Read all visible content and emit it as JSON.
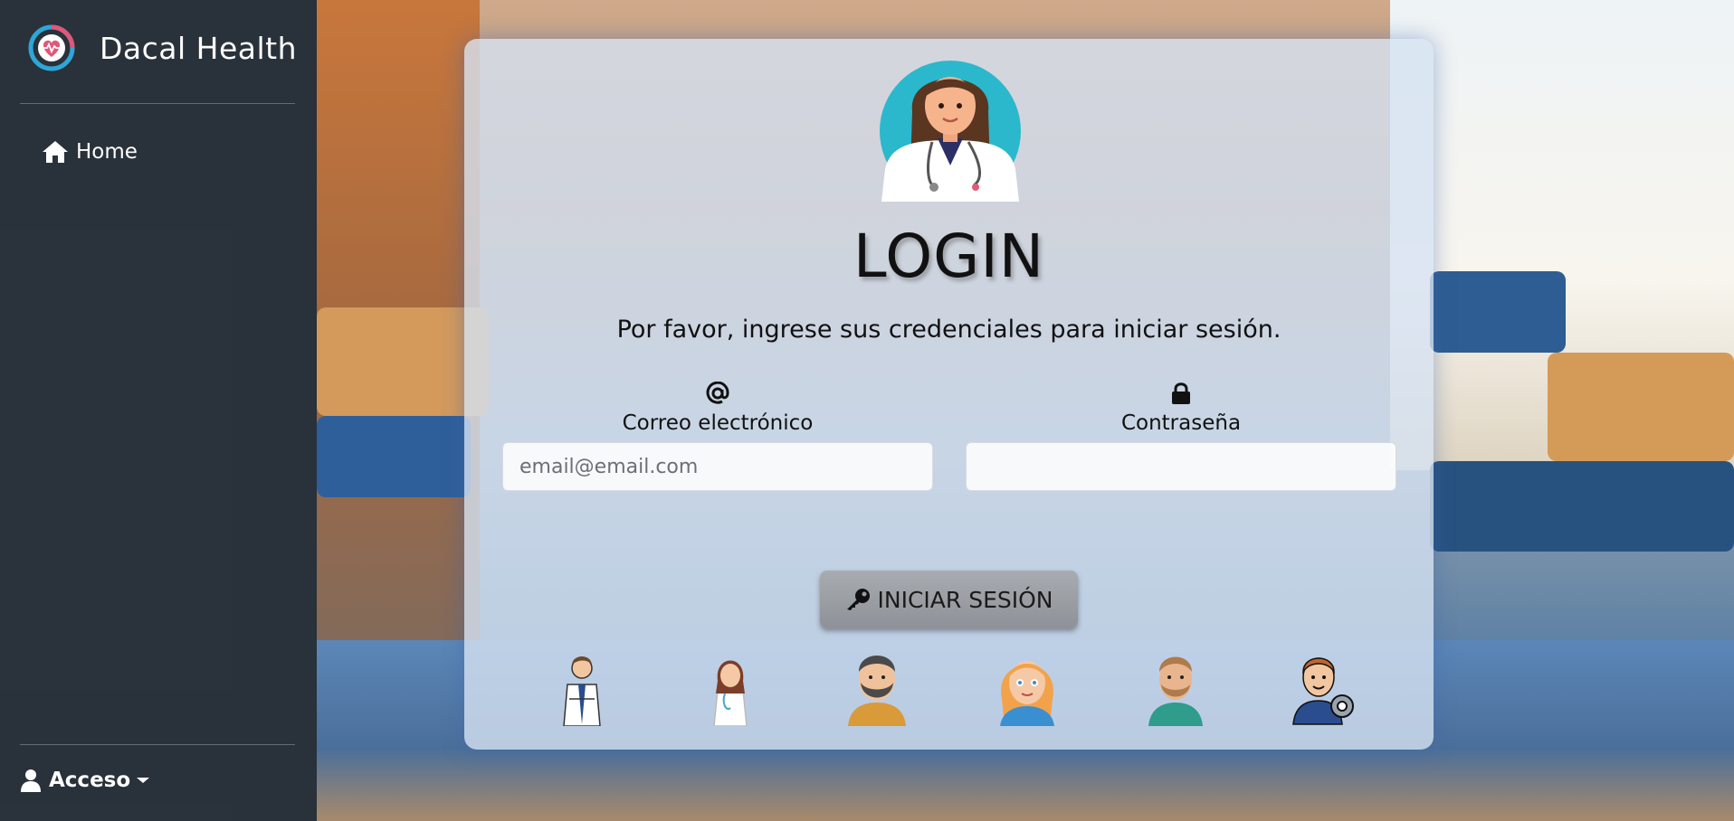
{
  "brand": {
    "name": "Dacal Health",
    "logo_icon": "heart-pulse-logo-icon"
  },
  "sidebar": {
    "items": [
      {
        "label": "Home",
        "icon": "home-icon"
      }
    ],
    "footer": {
      "label": "Acceso",
      "icon": "user-icon",
      "caret": "caret-down-icon"
    }
  },
  "login": {
    "title": "LOGIN",
    "subtitle": "Por favor, ingrese sus credenciales para iniciar sesión.",
    "email": {
      "icon": "at-sign-icon",
      "label": "Correo electrónico",
      "placeholder": "email@email.com",
      "value": ""
    },
    "password": {
      "icon": "lock-icon",
      "label": "Contraseña",
      "placeholder": "",
      "value": ""
    },
    "submit": {
      "icon": "key-icon",
      "label": "INICIAR SESIÓN"
    },
    "roles": [
      "doctor-male-avatar",
      "doctor-female-avatar",
      "bearded-man-avatar",
      "redhead-woman-avatar",
      "man-teal-shirt-avatar",
      "technician-gear-avatar"
    ]
  },
  "colors": {
    "sidebar_bg": "#20262e",
    "card_bg": "#d6e2f2",
    "button_bg": "#9a9ea4",
    "card_glow": "#3c64aa"
  }
}
